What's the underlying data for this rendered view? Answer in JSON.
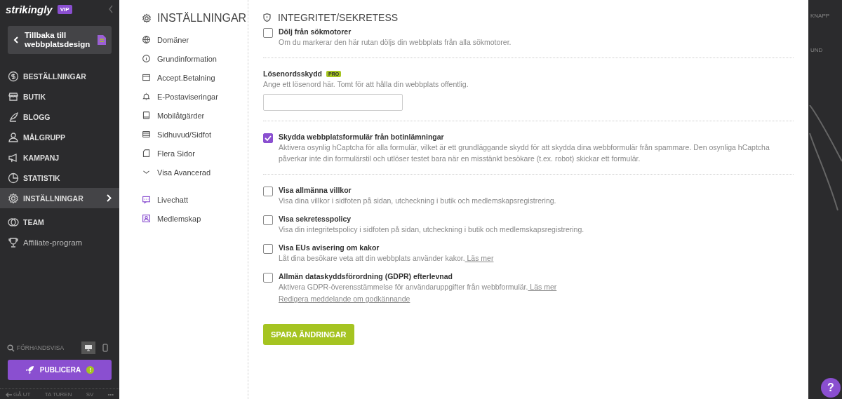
{
  "sidebar": {
    "logo": "strikingly",
    "plan_badge": "VIP",
    "back_button": "Tillbaka till webbplatsdesign",
    "items": [
      {
        "label": "BESTÄLLNINGAR",
        "selected": false
      },
      {
        "label": "BUTIK",
        "selected": false
      },
      {
        "label": "BLOGG",
        "selected": false
      },
      {
        "label": "MÅLGRUPP",
        "selected": false
      },
      {
        "label": "KAMPANJ",
        "selected": false
      },
      {
        "label": "STATISTIK",
        "selected": false
      },
      {
        "label": "INSTÄLLNINGAR",
        "selected": true
      },
      {
        "label": "TEAM",
        "selected": false
      },
      {
        "label": "Affiliate-program",
        "selected": false
      }
    ],
    "preview": "FÖRHANDSVISA",
    "devices": [
      {
        "selected": true
      },
      {
        "selected": false
      }
    ],
    "publish_button": "PUBLICERA",
    "publish_warning": "!",
    "footer": [
      "GÅ UT",
      "TA TUREN",
      "SV",
      "•••"
    ]
  },
  "settings_nav": {
    "title": "INSTÄLLNINGAR",
    "items": [
      {
        "label": "Domäner"
      },
      {
        "label": "Grundinformation"
      },
      {
        "label": "Accept.Betalning"
      },
      {
        "label": "E-Postaviseringar"
      },
      {
        "label": "Mobilåtgärder"
      },
      {
        "label": "Sidhuvud/Sidfot"
      },
      {
        "label": "Flera Sidor"
      },
      {
        "label": "Visa Avancerad"
      }
    ],
    "extra_items": [
      {
        "label": "Livechatt"
      },
      {
        "label": "Medlemskap"
      }
    ]
  },
  "panel": {
    "title": "INTEGRITET/SEKRETESS",
    "groups": [
      [
        {
          "kind": "checkbox",
          "label": "Dölj från sökmotorer",
          "checked": false,
          "description": "Om du markerar den här rutan döljs din webbplats från alla sökmotorer."
        }
      ],
      [
        {
          "kind": "password",
          "label": "Lösenordsskydd",
          "badge": "PRO",
          "description": "Ange ett lösenord här. Tomt för att hålla din webbplats offentlig."
        }
      ],
      [
        {
          "kind": "checkbox",
          "label": "Skydda webbplatsformulär från botinlämningar",
          "checked": true,
          "description": "Aktivera osynlig hCaptcha för alla formulär, vilket är ett grundläggande skydd för att skydda dina webbformulär från spammare. Den osynliga hCaptcha påverkar inte din formulärstil och utlöser testet bara när en misstänkt besökare (t.ex. robot) skickar ett formulär."
        }
      ],
      [
        {
          "kind": "checkbox",
          "label": "Visa allmänna villkor",
          "checked": false,
          "description": "Visa dina villkor i sidfoten på sidan, utcheckning i butik och medlemskapsregistrering."
        },
        {
          "kind": "checkbox",
          "label": "Visa sekretesspolicy",
          "checked": false,
          "description": "Visa din integritetspolicy i sidfoten på sidan, utcheckning i butik och medlemskapsregistrering."
        },
        {
          "kind": "checkbox",
          "label": "Visa EUs avisering om kakor",
          "checked": false,
          "description": "Låt dina besökare veta att din webbplats använder kakor.",
          "links": [
            "Läs mer"
          ]
        },
        {
          "kind": "checkbox",
          "label": "Allmän dataskyddsförordning (GDPR) efterlevnad",
          "checked": false,
          "description": "Aktivera GDPR-överensstämmelse för användaruppgifter från webbformulär.",
          "links": [
            "Läs mer",
            "Redigera meddelande om godkännande"
          ]
        }
      ]
    ],
    "save_button": "SPARA ÄNDRINGAR"
  },
  "preview_strip": {
    "texts": [
      "KNAPP",
      "UND"
    ],
    "help_button": "?"
  }
}
